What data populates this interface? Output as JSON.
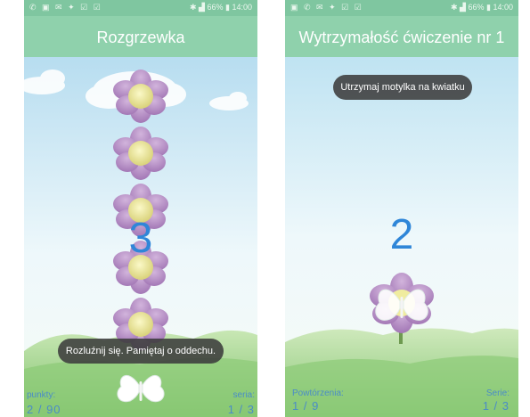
{
  "status_bar": {
    "battery": "66%",
    "time": "14:00",
    "signal_icons": [
      "bluetooth-icon",
      "lte-icon",
      "signal-icon",
      "battery-icon"
    ],
    "notification_icons": [
      "missed-call-icon",
      "image-icon",
      "mail-icon",
      "bird-icon",
      "check-icon",
      "check-icon"
    ]
  },
  "screens": [
    {
      "title": "Rozgrzewka",
      "counter": "3",
      "toast": "Rozluźnij się. Pamiętaj o oddechu.",
      "left_label": "punkty:",
      "left_value": "2 / 90",
      "right_label": "seria:",
      "right_value": "1 / 3",
      "flower_count": 5
    },
    {
      "title": "Wytrzymałość ćwiczenie nr 1",
      "counter": "2",
      "toast": "Utrzymaj motylka na kwiatku",
      "left_label": "Powtórzenia:",
      "left_value": "1 / 9",
      "right_label": "Serie:",
      "right_value": "1 / 3"
    }
  ],
  "colors": {
    "app_bar": "#8fd1ac",
    "status_bar": "#7fc6a0",
    "counter": "#2f86d8",
    "petal": "#b58bc4",
    "flower_center": "#f0ec9f",
    "grass": "#9ed08a"
  }
}
